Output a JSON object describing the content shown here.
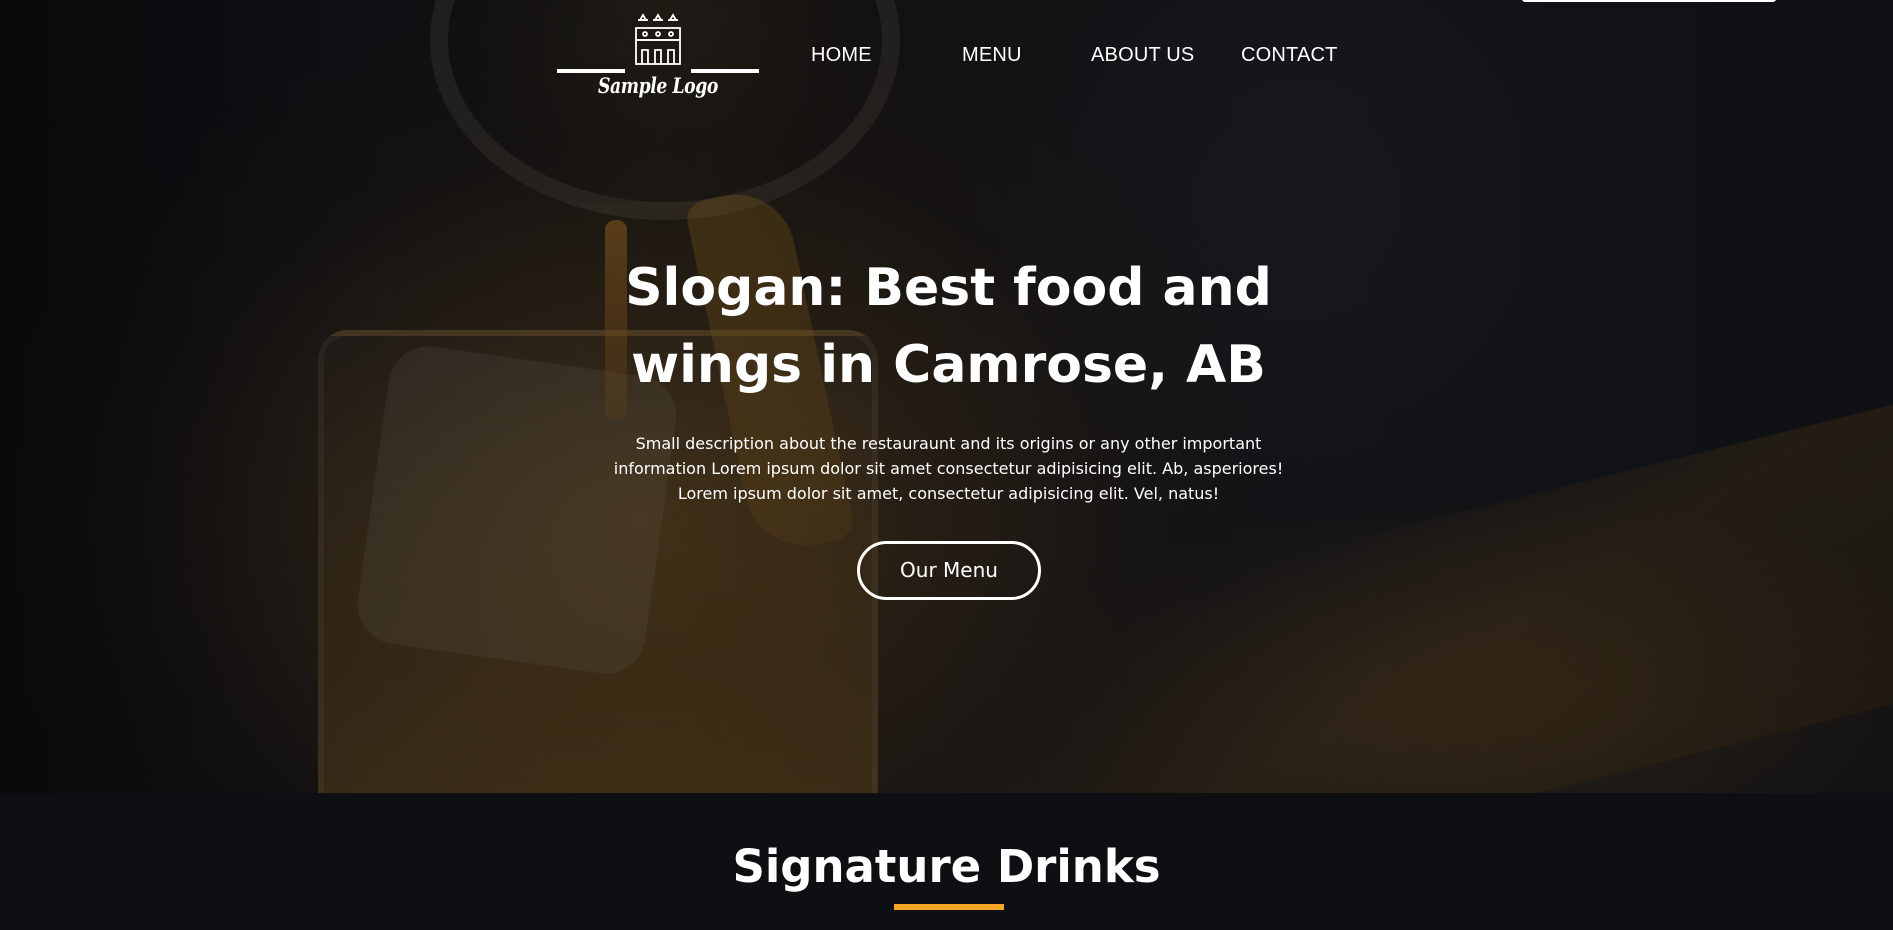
{
  "brand": {
    "logo_text": "Sample Logo"
  },
  "nav": {
    "items": [
      {
        "label": "HOME"
      },
      {
        "label": "MENU"
      },
      {
        "label": "ABOUT US"
      },
      {
        "label": "CONTACT"
      }
    ]
  },
  "hero": {
    "title_line1": "Slogan: Best food and",
    "title_line2": "wings in Camrose, AB",
    "description": "Small description about the restauraunt and its origins or any other important information Lorem ipsum dolor sit amet consectetur adipisicing elit. Ab, asperiores! Lorem ipsum dolor sit amet, consectetur adipisicing elit. Vel, natus!",
    "button_label": "Our Menu"
  },
  "signature": {
    "title": "Signature Drinks"
  },
  "colors": {
    "accent": "#f5a623",
    "background": "#0d0f12",
    "text": "#ffffff"
  },
  "icons": {
    "logo": "castle-icon"
  }
}
